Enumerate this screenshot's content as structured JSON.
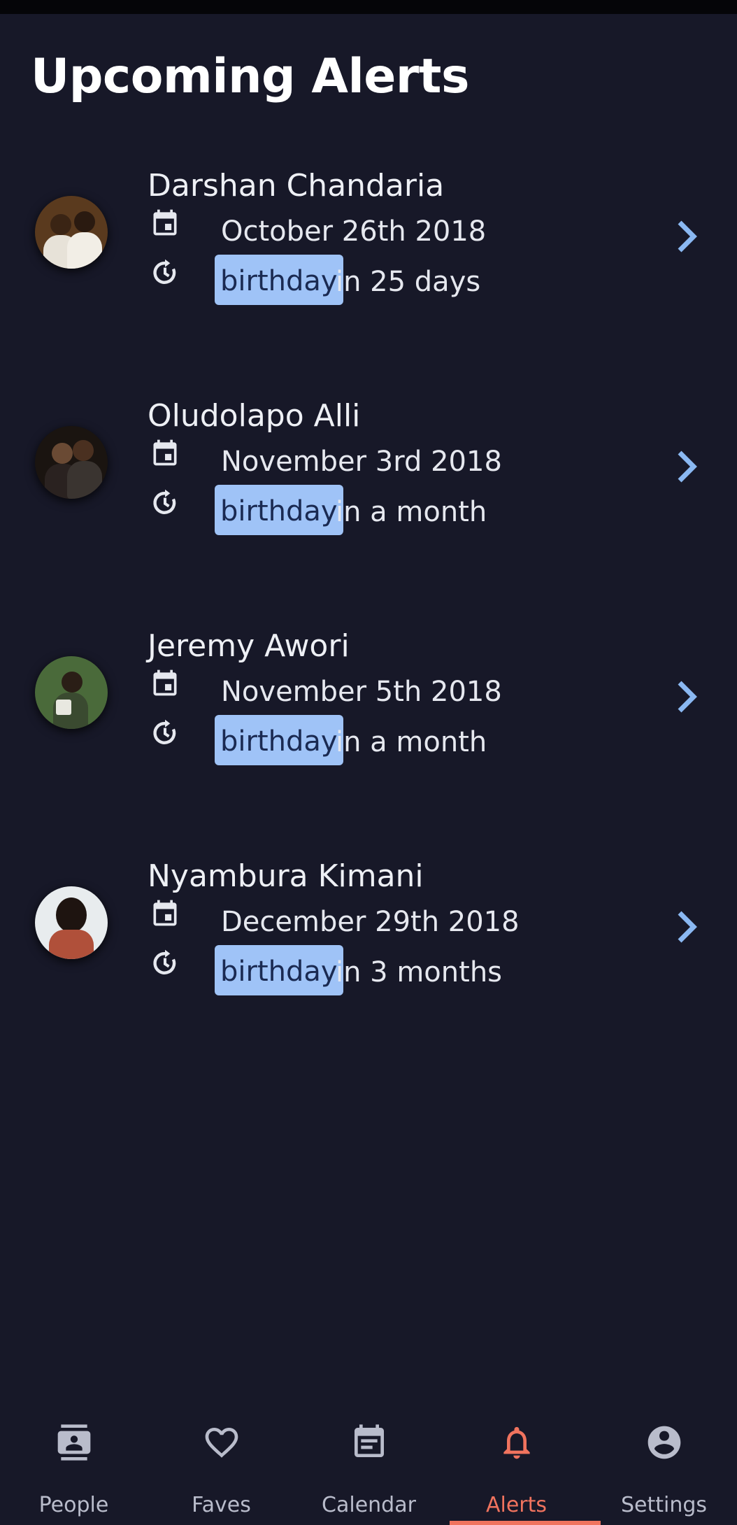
{
  "page": {
    "title": "Upcoming Alerts"
  },
  "alerts": [
    {
      "name": "Darshan Chandaria",
      "date": "October 26th 2018",
      "event": "birthday",
      "when": "in 25 days"
    },
    {
      "name": "Oludolapo Alli",
      "date": "November 3rd 2018",
      "event": "birthday",
      "when": "in a month"
    },
    {
      "name": "Jeremy Awori",
      "date": "November 5th 2018",
      "event": "birthday",
      "when": "in a month"
    },
    {
      "name": "Nyambura Kimani",
      "date": "December 29th 2018",
      "event": "birthday",
      "when": "in 3 months"
    }
  ],
  "nav": {
    "items": [
      {
        "label": "People",
        "icon": "contact-card-icon"
      },
      {
        "label": "Faves",
        "icon": "heart-icon"
      },
      {
        "label": "Calendar",
        "icon": "calendar-icon"
      },
      {
        "label": "Alerts",
        "icon": "bell-icon"
      },
      {
        "label": "Settings",
        "icon": "account-circle-icon"
      }
    ],
    "active": "Alerts"
  },
  "colors": {
    "background": "#171828",
    "tag_bg": "#9fc3f7",
    "chevron": "#8ab8f2",
    "accent": "#f0735e",
    "text": "#eef0f5"
  }
}
